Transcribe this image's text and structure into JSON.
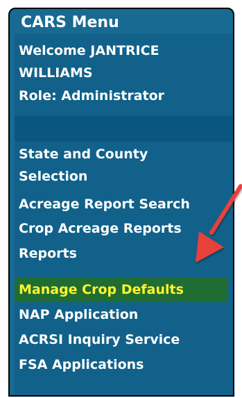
{
  "menu": {
    "title": "CARS Menu",
    "welcome": "Welcome JANTRICE WILLIAMS",
    "role": "Role: Administrator",
    "items": [
      {
        "label": "State and County Selection"
      },
      {
        "label": "Acreage Report Search"
      },
      {
        "label": "Crop Acreage Reports"
      },
      {
        "label": "Reports"
      },
      {
        "label": "Manage Crop Defaults",
        "active": true
      },
      {
        "label": "NAP Application"
      },
      {
        "label": "ACRSI Inquiry Service"
      },
      {
        "label": "FSA Applications"
      }
    ]
  },
  "colors": {
    "panel": "#186a93",
    "active_background": "#1f6d33",
    "active_text": "#fff52c",
    "annotation_arrow": "#e8413a"
  },
  "annotation": {
    "icon": "red-arrow-icon"
  }
}
